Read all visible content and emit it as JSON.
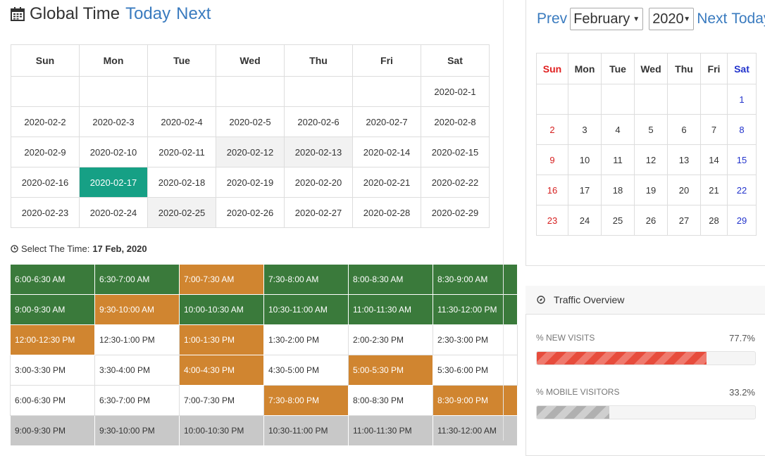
{
  "header": {
    "title": "Global Time",
    "today": "Today",
    "next": "Next"
  },
  "calendar": {
    "weekdays": [
      "Sun",
      "Mon",
      "Tue",
      "Wed",
      "Thu",
      "Fri",
      "Sat"
    ],
    "weeks": [
      [
        "",
        "",
        "",
        "",
        "",
        "",
        "2020-02-1"
      ],
      [
        "2020-02-2",
        "2020-02-3",
        "2020-02-4",
        "2020-02-5",
        "2020-02-6",
        "2020-02-7",
        "2020-02-8"
      ],
      [
        "2020-02-9",
        "2020-02-10",
        "2020-02-11",
        "2020-02-12",
        "2020-02-13",
        "2020-02-14",
        "2020-02-15"
      ],
      [
        "2020-02-16",
        "2020-02-17",
        "2020-02-18",
        "2020-02-19",
        "2020-02-20",
        "2020-02-21",
        "2020-02-22"
      ],
      [
        "2020-02-23",
        "2020-02-24",
        "2020-02-25",
        "2020-02-26",
        "2020-02-27",
        "2020-02-28",
        "2020-02-29"
      ]
    ],
    "states": [
      [
        "",
        "",
        "",
        "",
        "",
        "",
        ""
      ],
      [
        "",
        "",
        "",
        "",
        "",
        "",
        ""
      ],
      [
        "",
        "",
        "",
        "gray",
        "gray",
        "",
        ""
      ],
      [
        "",
        "sel",
        "",
        "",
        "",
        "",
        ""
      ],
      [
        "",
        "",
        "gray",
        "",
        "",
        "",
        ""
      ]
    ]
  },
  "time_select": {
    "label": "Select The Time:",
    "date": "17 Feb, 2020"
  },
  "slots": [
    [
      [
        "6:00-6:30 AM",
        "green"
      ],
      [
        "6:30-7:00 AM",
        "green"
      ],
      [
        "7:00-7:30 AM",
        "orange"
      ],
      [
        "7:30-8:00 AM",
        "green"
      ],
      [
        "8:00-8:30 AM",
        "green"
      ],
      [
        "8:30-9:00 AM",
        "green"
      ]
    ],
    [
      [
        "9:00-9:30 AM",
        "green"
      ],
      [
        "9:30-10:00 AM",
        "orange"
      ],
      [
        "10:00-10:30 AM",
        "green"
      ],
      [
        "10:30-11:00 AM",
        "green"
      ],
      [
        "11:00-11:30 AM",
        "green"
      ],
      [
        "11:30-12:00 PM",
        "green"
      ]
    ],
    [
      [
        "12:00-12:30 PM",
        "orange"
      ],
      [
        "12:30-1:00 PM",
        "white"
      ],
      [
        "1:00-1:30 PM",
        "orange"
      ],
      [
        "1:30-2:00 PM",
        "white"
      ],
      [
        "2:00-2:30 PM",
        "white"
      ],
      [
        "2:30-3:00 PM",
        "white"
      ]
    ],
    [
      [
        "3:00-3:30 PM",
        "white"
      ],
      [
        "3:30-4:00 PM",
        "white"
      ],
      [
        "4:00-4:30 PM",
        "orange"
      ],
      [
        "4:30-5:00 PM",
        "white"
      ],
      [
        "5:00-5:30 PM",
        "orange"
      ],
      [
        "5:30-6:00 PM",
        "white"
      ]
    ],
    [
      [
        "6:00-6:30 PM",
        "white"
      ],
      [
        "6:30-7:00 PM",
        "white"
      ],
      [
        "7:00-7:30 PM",
        "white"
      ],
      [
        "7:30-8:00 PM",
        "orange"
      ],
      [
        "8:00-8:30 PM",
        "white"
      ],
      [
        "8:30-9:00 PM",
        "orange"
      ]
    ],
    [
      [
        "9:00-9:30 PM",
        "grey"
      ],
      [
        "9:30-10:00 PM",
        "grey"
      ],
      [
        "10:00-10:30 PM",
        "grey"
      ],
      [
        "10:30-11:00 PM",
        "grey"
      ],
      [
        "11:00-11:30 PM",
        "grey"
      ],
      [
        "11:30-12:00 AM",
        "grey"
      ]
    ]
  ],
  "slot_colors": {
    "green": "#3a7a3b",
    "orange": "#d08530",
    "grey": "#c8c8c8",
    "selected_day": "#16a085"
  },
  "mini_nav": {
    "prev": "Prev",
    "month": "February",
    "year": "2020",
    "next": "Next",
    "today": "Today"
  },
  "mini_calendar": {
    "weekdays": [
      "Sun",
      "Mon",
      "Tue",
      "Wed",
      "Thu",
      "Fri",
      "Sat"
    ],
    "weeks": [
      [
        "",
        "",
        "",
        "",
        "",
        "",
        "1"
      ],
      [
        "2",
        "3",
        "4",
        "5",
        "6",
        "7",
        "8"
      ],
      [
        "9",
        "10",
        "11",
        "12",
        "13",
        "14",
        "15"
      ],
      [
        "16",
        "17",
        "18",
        "19",
        "20",
        "21",
        "22"
      ],
      [
        "23",
        "24",
        "25",
        "26",
        "27",
        "28",
        "29"
      ]
    ]
  },
  "traffic": {
    "title": "Traffic Overview",
    "metrics": [
      {
        "label": "% NEW VISITS",
        "value": "77.7%",
        "fraction": 0.777,
        "color": "red"
      },
      {
        "label": "% MOBILE VISITORS",
        "value": "33.2%",
        "fraction": 0.332,
        "color": "grey"
      }
    ]
  }
}
